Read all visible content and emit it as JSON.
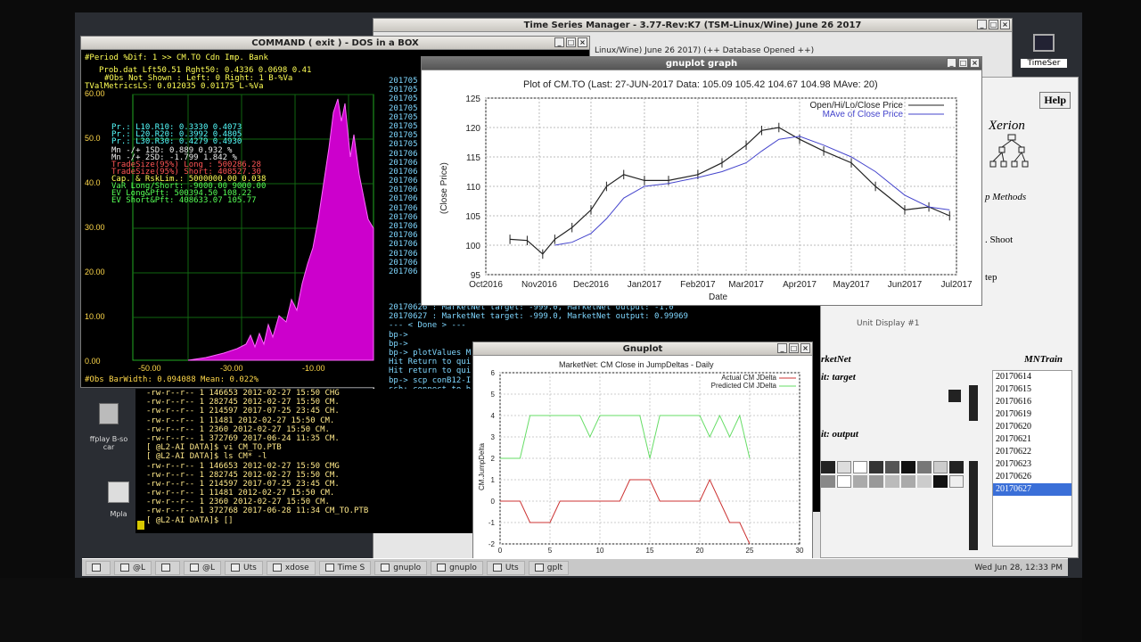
{
  "colors": {
    "magenta": "#cc00cc",
    "green_series": "#66dd66",
    "red_series": "#cc3333",
    "mave": "#4444cc"
  },
  "tsm": {
    "title": "Time Series Manager - 3.77-Rev:K7 (TSM-Linux/Wine) June 26 2017",
    "status": "Linux/Wine) June 26 2017)   (++ Database Opened ++)",
    "help_label": "Help",
    "xerion": "Xerion",
    "p_methods": "p Methods",
    "shoot": ". Shoot",
    "tep": "tep",
    "unit_display": "Unit Display #1",
    "marketnet": "rketNet",
    "mntrain": "MNTrain",
    "target": "it: target",
    "output": "it: output"
  },
  "desktop_icon_label": "TimeSer",
  "dos": {
    "title": "COMMAND ( exit ) - DOS in a BOX",
    "lines": [
      {
        "t": "#Period %Dif: 1 >>  CM.TO         Cdn Imp. Bank",
        "c": "yellow"
      },
      {
        "t": "    Prob.dat Lft50.51 Rght50: 0.4336 0.0698 0.41",
        "c": "yellow"
      },
      {
        "t": "      #Obs Not Shown : Left: 0 Right: 1   B-%Va",
        "c": "yellow"
      },
      {
        "t": "TValMetricsLS: 0.012035  0.01175    L-%Va",
        "c": "yellow"
      },
      {
        "t": "Pr.: L10.R10: 0.3330 0.4073",
        "c": "cyan"
      },
      {
        "t": "Pr.: L20.R20: 0.3992 0.4805",
        "c": "cyan"
      },
      {
        "t": "Pr.: L30.R30: 0.4279 0.4930",
        "c": "cyan"
      },
      {
        "t": "Mn -/+ 1SD:  0.889  0.932 %",
        "c": "white"
      },
      {
        "t": "Mn -/+ 2SD: -1.799  1.842 %",
        "c": "white"
      },
      {
        "t": "TradeSize(95%) Long : 500286.28",
        "c": "red"
      },
      {
        "t": "TradeSize(95%) Short: 408527.30",
        "c": "red"
      },
      {
        "t": "Cap. & RskLim.: 5000000.00  0.038",
        "c": "yellow"
      },
      {
        "t": "VaR Long/Short:  -9000.00  9000.00",
        "c": "green"
      },
      {
        "t": "EV Long&Pft: 500394.50  108.22",
        "c": "green"
      },
      {
        "t": "EV Short&Pft: 408633.07  105.77",
        "c": "green"
      }
    ],
    "y_ticks": [
      "60.00",
      "50.0",
      "40.0",
      "30.00",
      "20.00",
      "10.00",
      "0.00"
    ],
    "x_ticks": [
      "-50.00",
      "-30.00",
      "-10.00"
    ],
    "footer": "#Obs      BarWidth: 0.094088    Mean: 0.022%"
  },
  "ls_term": {
    "lines": [
      "-rw-r--r-- 1         146653 2012-02-27 15:50 CHG",
      "-rw-r--r-- 1         282745 2012-02-27 15:50 CM.",
      "-rw-r--r-- 1         214597 2017-07-25 23:45 CH.",
      "-rw-r--r-- 1          11481 2012-02-27 15:50 CM.",
      "-rw-r--r-- 1           2360 2012-02-27 15:50 CM.",
      "-rw-r--r-- 1         372769 2017-06-24 11:35 CM.",
      "[   @L2-AI DATA]$ vi CM_TO.PTB",
      "[   @L2-AI DATA]$ ls CM* -l",
      "-rw-r--r-- 1         146653 2012-02-27 15:50 CMG",
      "-rw-r--r-- 1         282745 2012-02-27 15:50 CM.",
      "-rw-r--r-- 1         214597 2017-07-25 23:45 CM.",
      "-rw-r--r-- 1          11481 2012-02-27 15:50 CM.",
      "-rw-r--r-- 1           2360 2012-02-27 15:50 CM.",
      "-rw-r--r-- 1         372768 2017-06-28 11:34 CM_TO.PTB",
      "[   @L2-AI DATA]$ []"
    ]
  },
  "dates_term": {
    "dates": [
      "201705",
      "201705",
      "201705",
      "201705",
      "201705",
      "201705",
      "201705",
      "201705",
      "201706",
      "201706",
      "201706",
      "201706",
      "201706",
      "201706",
      "201706",
      "201706",
      "201706",
      "201706",
      "201706",
      "201706",
      "201706",
      "201706"
    ],
    "lines": [
      "20170626 :  MarketNet target: -999.0,  MarketNet output: -1.0",
      "20170627 :  MarketNet target: -999.0,  MarketNet output: 0.99969",
      "--- < Done > ---",
      "bp->",
      "bp->",
      "bp-> plotValues M",
      "Hit Return to qui",
      "Hit return to qui",
      "bp-> scp conB12-I",
      "ssh: connect to h",
      "bp-> source plotV",
      "bp-> plotValues M",
      "Hit Return to qui",
      "Hit return to qui",
      "bp-> plotValues M",
      "Hit Return to qui",
      "bp-> plotValues M",
      "Hit Return to qui",
      "Hit return to qui",
      "bp-> plotValues M",
      "Hit Return to qui"
    ]
  },
  "ffplay_label": "ffplay B-so car",
  "mpla_label": "Mpla",
  "gnuplot_main": {
    "window_title": "gnuplot graph",
    "title": "Plot of CM.TO  (Last: 27-JUN-2017    Data: 105.09 105.42 104.67 104.98     MAve: 20)",
    "legend1": "Open/Hi/Lo/Close Price",
    "legend2": "MAve of Close Price",
    "ylabel": "(Close Price)",
    "xlabel": "Date",
    "y_ticks": [
      "125",
      "120",
      "115",
      "110",
      "105",
      "100",
      "95"
    ],
    "x_ticks": [
      "Oct2016",
      "Nov2016",
      "Dec2016",
      "Jan2017",
      "Feb2017",
      "Mar2017",
      "Apr2017",
      "May2017",
      "Jun2017",
      "Jul2017"
    ]
  },
  "gnuplot_small": {
    "window_title": "Gnuplot",
    "title": "MarketNet: CM Close in JumpDeltas - Daily",
    "legend1": "Actual CM JDelta",
    "legend2": "Predicted CM JDelta",
    "ylabel": "CM.JumpDelta",
    "y_ticks": [
      "6",
      "5",
      "4",
      "3",
      "2",
      "1",
      "0",
      "-1",
      "-2"
    ],
    "x_ticks": [
      "0",
      "5",
      "10",
      "15",
      "20",
      "25",
      "30"
    ]
  },
  "chart_data": [
    {
      "type": "line",
      "title": "Plot of CM.TO  (Last: 27-JUN-2017    Data: 105.09 105.42 104.67 104.98     MAve: 20)",
      "xlabel": "Date",
      "ylabel": "(Close Price)",
      "ylim": [
        95,
        125
      ],
      "x": [
        "2016-10-15",
        "2016-10-25",
        "2016-11-03",
        "2016-11-10",
        "2016-11-20",
        "2016-12-01",
        "2016-12-10",
        "2016-12-20",
        "2017-01-01",
        "2017-01-15",
        "2017-02-01",
        "2017-02-15",
        "2017-03-01",
        "2017-03-10",
        "2017-03-20",
        "2017-04-01",
        "2017-04-15",
        "2017-05-01",
        "2017-05-15",
        "2017-06-01",
        "2017-06-15",
        "2017-06-27"
      ],
      "series": [
        {
          "name": "Open/Hi/Lo/Close Price",
          "values": [
            101,
            100.8,
            98.5,
            101,
            103,
            106,
            110,
            112,
            111,
            111,
            112,
            114,
            117,
            119.5,
            120,
            118,
            116,
            114,
            110,
            106,
            106.5,
            105
          ]
        },
        {
          "name": "MAve of Close Price",
          "values": [
            null,
            null,
            null,
            100,
            100.5,
            102,
            104.5,
            108,
            110,
            110.5,
            111.5,
            112.5,
            114,
            116,
            118,
            118.5,
            117,
            115,
            112.5,
            108.5,
            106.5,
            106
          ]
        }
      ]
    },
    {
      "type": "line",
      "title": "MarketNet: CM Close in JumpDeltas - Daily",
      "ylabel": "CM.JumpDelta",
      "xlim": [
        0,
        30
      ],
      "ylim": [
        -2,
        6
      ],
      "x": [
        0,
        2,
        3,
        4,
        5,
        6,
        7,
        8,
        9,
        10,
        11,
        12,
        13,
        14,
        15,
        16,
        17,
        18,
        19,
        20,
        21,
        22,
        23,
        24,
        25
      ],
      "series": [
        {
          "name": "Actual CM JDelta",
          "values": [
            0,
            0,
            -1,
            -1,
            -1,
            0,
            0,
            0,
            0,
            0,
            0,
            0,
            1,
            1,
            1,
            0,
            0,
            0,
            0,
            0,
            1,
            0,
            -1,
            -1,
            -2
          ]
        },
        {
          "name": "Predicted CM JDelta",
          "values": [
            2,
            2,
            4,
            4,
            4,
            4,
            4,
            4,
            3,
            4,
            4,
            4,
            4,
            4,
            2,
            4,
            4,
            4,
            4,
            4,
            3,
            4,
            3,
            4,
            2
          ]
        }
      ]
    }
  ],
  "right_list": [
    "20170614",
    "20170615",
    "20170616",
    "20170619",
    "20170620",
    "20170621",
    "20170622",
    "20170623",
    "20170626",
    "20170627"
  ],
  "taskbar": {
    "items": [
      "",
      "@L",
      "",
      "@L",
      "Uts",
      "xdose",
      "Time S",
      "gnuplo",
      "gnuplo",
      "Uts",
      "gplt"
    ],
    "clock": "Wed Jun 28, 12:33 PM"
  }
}
